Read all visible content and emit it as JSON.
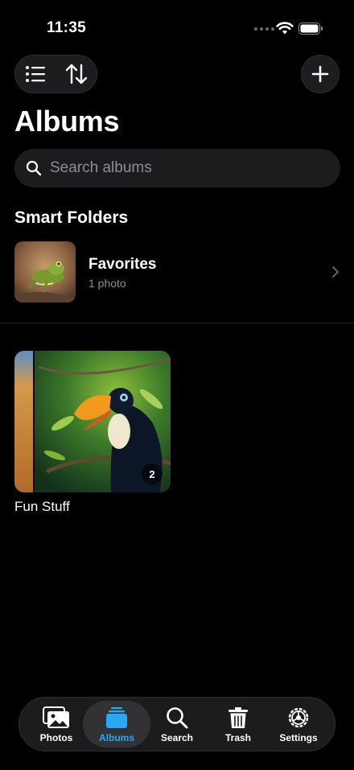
{
  "status_bar": {
    "time": "11:35"
  },
  "header": {
    "title": "Albums"
  },
  "search": {
    "placeholder": "Search albums"
  },
  "smart_folders": {
    "heading": "Smart Folders",
    "items": [
      {
        "name": "Favorites",
        "count": "1 photo"
      }
    ]
  },
  "albums": [
    {
      "name": "Fun Stuff",
      "count": "2"
    }
  ],
  "tab_bar": {
    "items": [
      {
        "label": "Photos",
        "icon": "photos-icon"
      },
      {
        "label": "Albums",
        "icon": "albums-icon",
        "active": true
      },
      {
        "label": "Search",
        "icon": "search-icon"
      },
      {
        "label": "Trash",
        "icon": "trash-icon"
      },
      {
        "label": "Settings",
        "icon": "settings-icon"
      }
    ]
  },
  "colors": {
    "accent": "#2aa8f8",
    "background": "#000000",
    "surface": "#1c1c1e"
  }
}
